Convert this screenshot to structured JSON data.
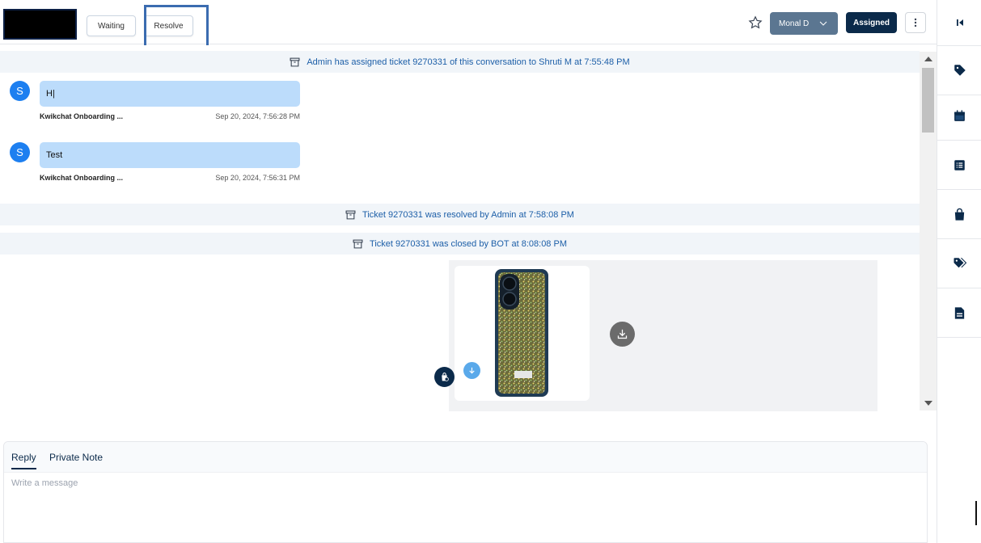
{
  "header": {
    "waiting_label": "Waiting",
    "resolve_label": "Resolve",
    "agent_name": "Monal D",
    "assigned_label": "Assigned"
  },
  "system_messages": [
    "Admin has assigned ticket 9270331 of this conversation to Shruti M at 7:55:48 PM",
    "Ticket 9270331 was resolved by Admin at 7:58:08 PM",
    "Ticket 9270331 was closed by BOT at 8:08:08 PM"
  ],
  "messages": [
    {
      "avatar": "S",
      "text": "H|",
      "sender": "Kwikchat Onboarding ...",
      "time": "Sep 20, 2024, 7:56:28 PM"
    },
    {
      "avatar": "S",
      "text": "Test",
      "sender": "Kwikchat Onboarding ...",
      "time": "Sep 20, 2024, 7:56:31 PM"
    }
  ],
  "composer": {
    "tabs": [
      "Reply",
      "Private Note"
    ],
    "placeholder": "Write a message"
  },
  "sidebar_icons": [
    "collapse-icon",
    "tag-icon",
    "calendar-icon",
    "list-icon",
    "bag-icon",
    "tags-icon",
    "document-icon"
  ],
  "colors": {
    "primary": "#0b2a4a",
    "bubble": "#bcdcfb",
    "avatar": "#1d7ff0",
    "system_text": "#1d5fa8",
    "highlight": "#3b6cb0"
  }
}
